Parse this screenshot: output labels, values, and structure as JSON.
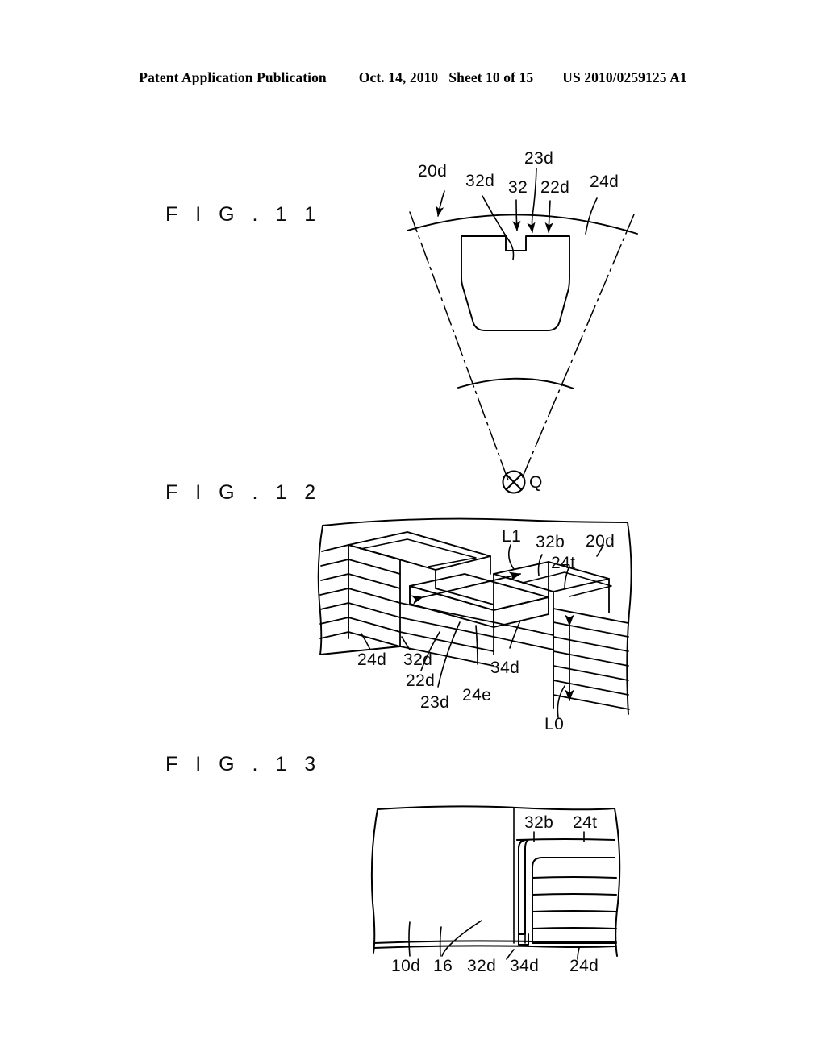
{
  "header": {
    "publication": "Patent Application Publication",
    "date": "Oct. 14, 2010",
    "sheet": "Sheet 10 of 15",
    "patent_number": "US 2010/0259125 A1"
  },
  "figures": [
    {
      "id": "fig11",
      "caption": "F I G .  1 1",
      "description": "Sector (pie-wedge) cross-section of a stator core segment with a rounded-trapezoid slot having a small rectangular notch at the top center; dash-dot radial center lines converge on axis point Q.",
      "labels": [
        {
          "key": "l20d",
          "text": "20d"
        },
        {
          "key": "l32d",
          "text": "32d"
        },
        {
          "key": "l32",
          "text": "32"
        },
        {
          "key": "l23d",
          "text": "23d"
        },
        {
          "key": "l22d",
          "text": "22d"
        },
        {
          "key": "l24d",
          "text": "24d"
        },
        {
          "key": "lQ",
          "text": "Q"
        }
      ]
    },
    {
      "id": "fig12",
      "caption": "F I G .  1 2",
      "description": "Isometric cut-away view of laminated core teeth showing stacked steel sheets, a projecting tooth tip and dimension arrows L1 (horizontal) and L0 (vertical).",
      "labels": [
        {
          "key": "lL1",
          "text": "L1"
        },
        {
          "key": "l32b",
          "text": "32b"
        },
        {
          "key": "l20d",
          "text": "20d"
        },
        {
          "key": "l24t",
          "text": "24t"
        },
        {
          "key": "l24d",
          "text": "24d"
        },
        {
          "key": "l32d",
          "text": "32d"
        },
        {
          "key": "l22d",
          "text": "22d"
        },
        {
          "key": "l23d",
          "text": "23d"
        },
        {
          "key": "l24e",
          "text": "24e"
        },
        {
          "key": "l34d",
          "text": "34d"
        },
        {
          "key": "lL0",
          "text": "L0"
        }
      ]
    },
    {
      "id": "fig13",
      "caption": "F I G .  1 3",
      "description": "Enlarged side sectional view of the laminated stack edge showing a rounded corner 32b, the thin strip 32d, gap 34d and the layered teeth 24d with top layer 24t above base 10d and thin layer 16.",
      "labels": [
        {
          "key": "l32b",
          "text": "32b"
        },
        {
          "key": "l24t",
          "text": "24t"
        },
        {
          "key": "l10d",
          "text": "10d"
        },
        {
          "key": "l16",
          "text": "16"
        },
        {
          "key": "l32d",
          "text": "32d"
        },
        {
          "key": "l34d",
          "text": "34d"
        },
        {
          "key": "l24d",
          "text": "24d"
        }
      ]
    }
  ],
  "colors": {
    "ink": "#000000",
    "paper": "#ffffff"
  }
}
